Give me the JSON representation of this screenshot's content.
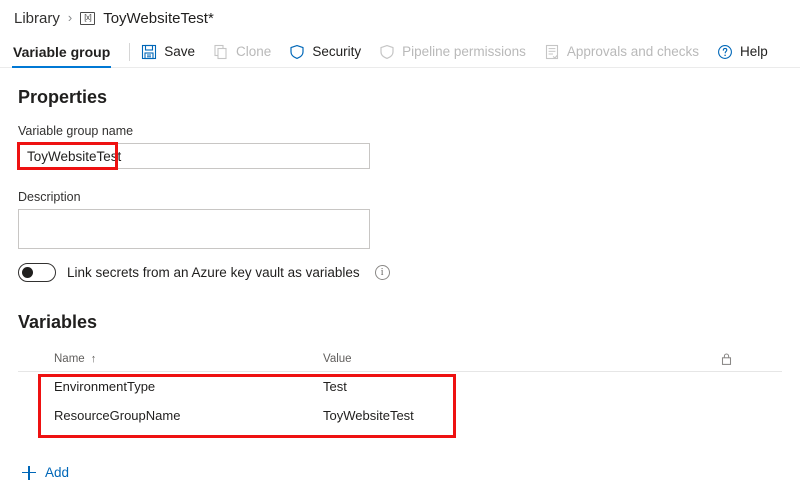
{
  "breadcrumb": {
    "root_label": "Library",
    "separator": "›",
    "group_icon": "variable-group-icon",
    "group_icon_text": "[x]",
    "current_label": "ToyWebsiteTest*"
  },
  "toolbar": {
    "tab_label": "Variable group",
    "items": [
      {
        "label": "Save",
        "icon": "save-icon",
        "disabled": false
      },
      {
        "label": "Clone",
        "icon": "clone-icon",
        "disabled": true
      },
      {
        "label": "Security",
        "icon": "shield-icon",
        "disabled": false
      },
      {
        "label": "Pipeline permissions",
        "icon": "shield-icon",
        "disabled": true
      },
      {
        "label": "Approvals and checks",
        "icon": "checklist-icon",
        "disabled": true
      },
      {
        "label": "Help",
        "icon": "help-circle-icon",
        "disabled": false
      }
    ]
  },
  "properties": {
    "heading": "Properties",
    "name_label": "Variable group name",
    "name_value": "ToyWebsiteTest",
    "name_placeholder": "",
    "description_label": "Description",
    "description_value": "",
    "description_placeholder": "",
    "link_secrets_label": "Link secrets from an Azure key vault as variables",
    "link_secrets_on": false,
    "info_icon": "info-icon",
    "info_glyph": "i"
  },
  "variables": {
    "heading": "Variables",
    "columns": {
      "name": "Name",
      "sort_indicator": "↑",
      "value": "Value",
      "lock": "lock-icon"
    },
    "rows": [
      {
        "name": "EnvironmentType",
        "value": "Test"
      },
      {
        "name": "ResourceGroupName",
        "value": "ToyWebsiteTest"
      }
    ],
    "add_label": "Add"
  },
  "colors": {
    "accent": "#0078d4",
    "link": "#0067b8",
    "highlight": "#ee1111",
    "text": "#201f1e",
    "muted": "#605e5c",
    "disabled": "#b9b9b9"
  }
}
